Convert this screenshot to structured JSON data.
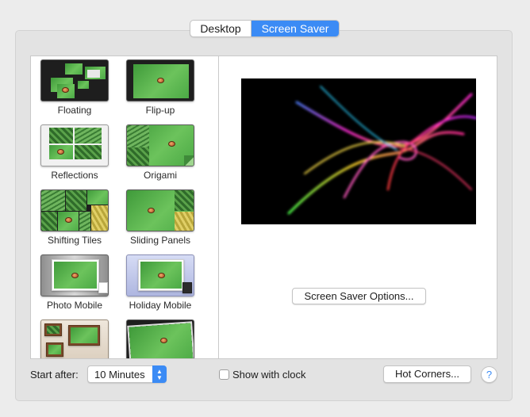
{
  "tabs": [
    {
      "label": "Desktop",
      "active": false
    },
    {
      "label": "Screen Saver",
      "active": true
    }
  ],
  "screensavers": [
    {
      "name": "Floating"
    },
    {
      "name": "Flip-up"
    },
    {
      "name": "Reflections"
    },
    {
      "name": "Origami"
    },
    {
      "name": "Shifting Tiles"
    },
    {
      "name": "Sliding Panels"
    },
    {
      "name": "Photo Mobile"
    },
    {
      "name": "Holiday Mobile"
    },
    {
      "name": ""
    },
    {
      "name": ""
    }
  ],
  "preview": {
    "options_button": "Screen Saver Options..."
  },
  "footer": {
    "start_after_label": "Start after:",
    "start_after_value": "10 Minutes",
    "show_clock_label": "Show with clock",
    "show_clock_checked": false,
    "hot_corners_button": "Hot Corners...",
    "help_glyph": "?"
  },
  "colors": {
    "accent": "#3b8bf5",
    "window_bg": "#ececec"
  }
}
